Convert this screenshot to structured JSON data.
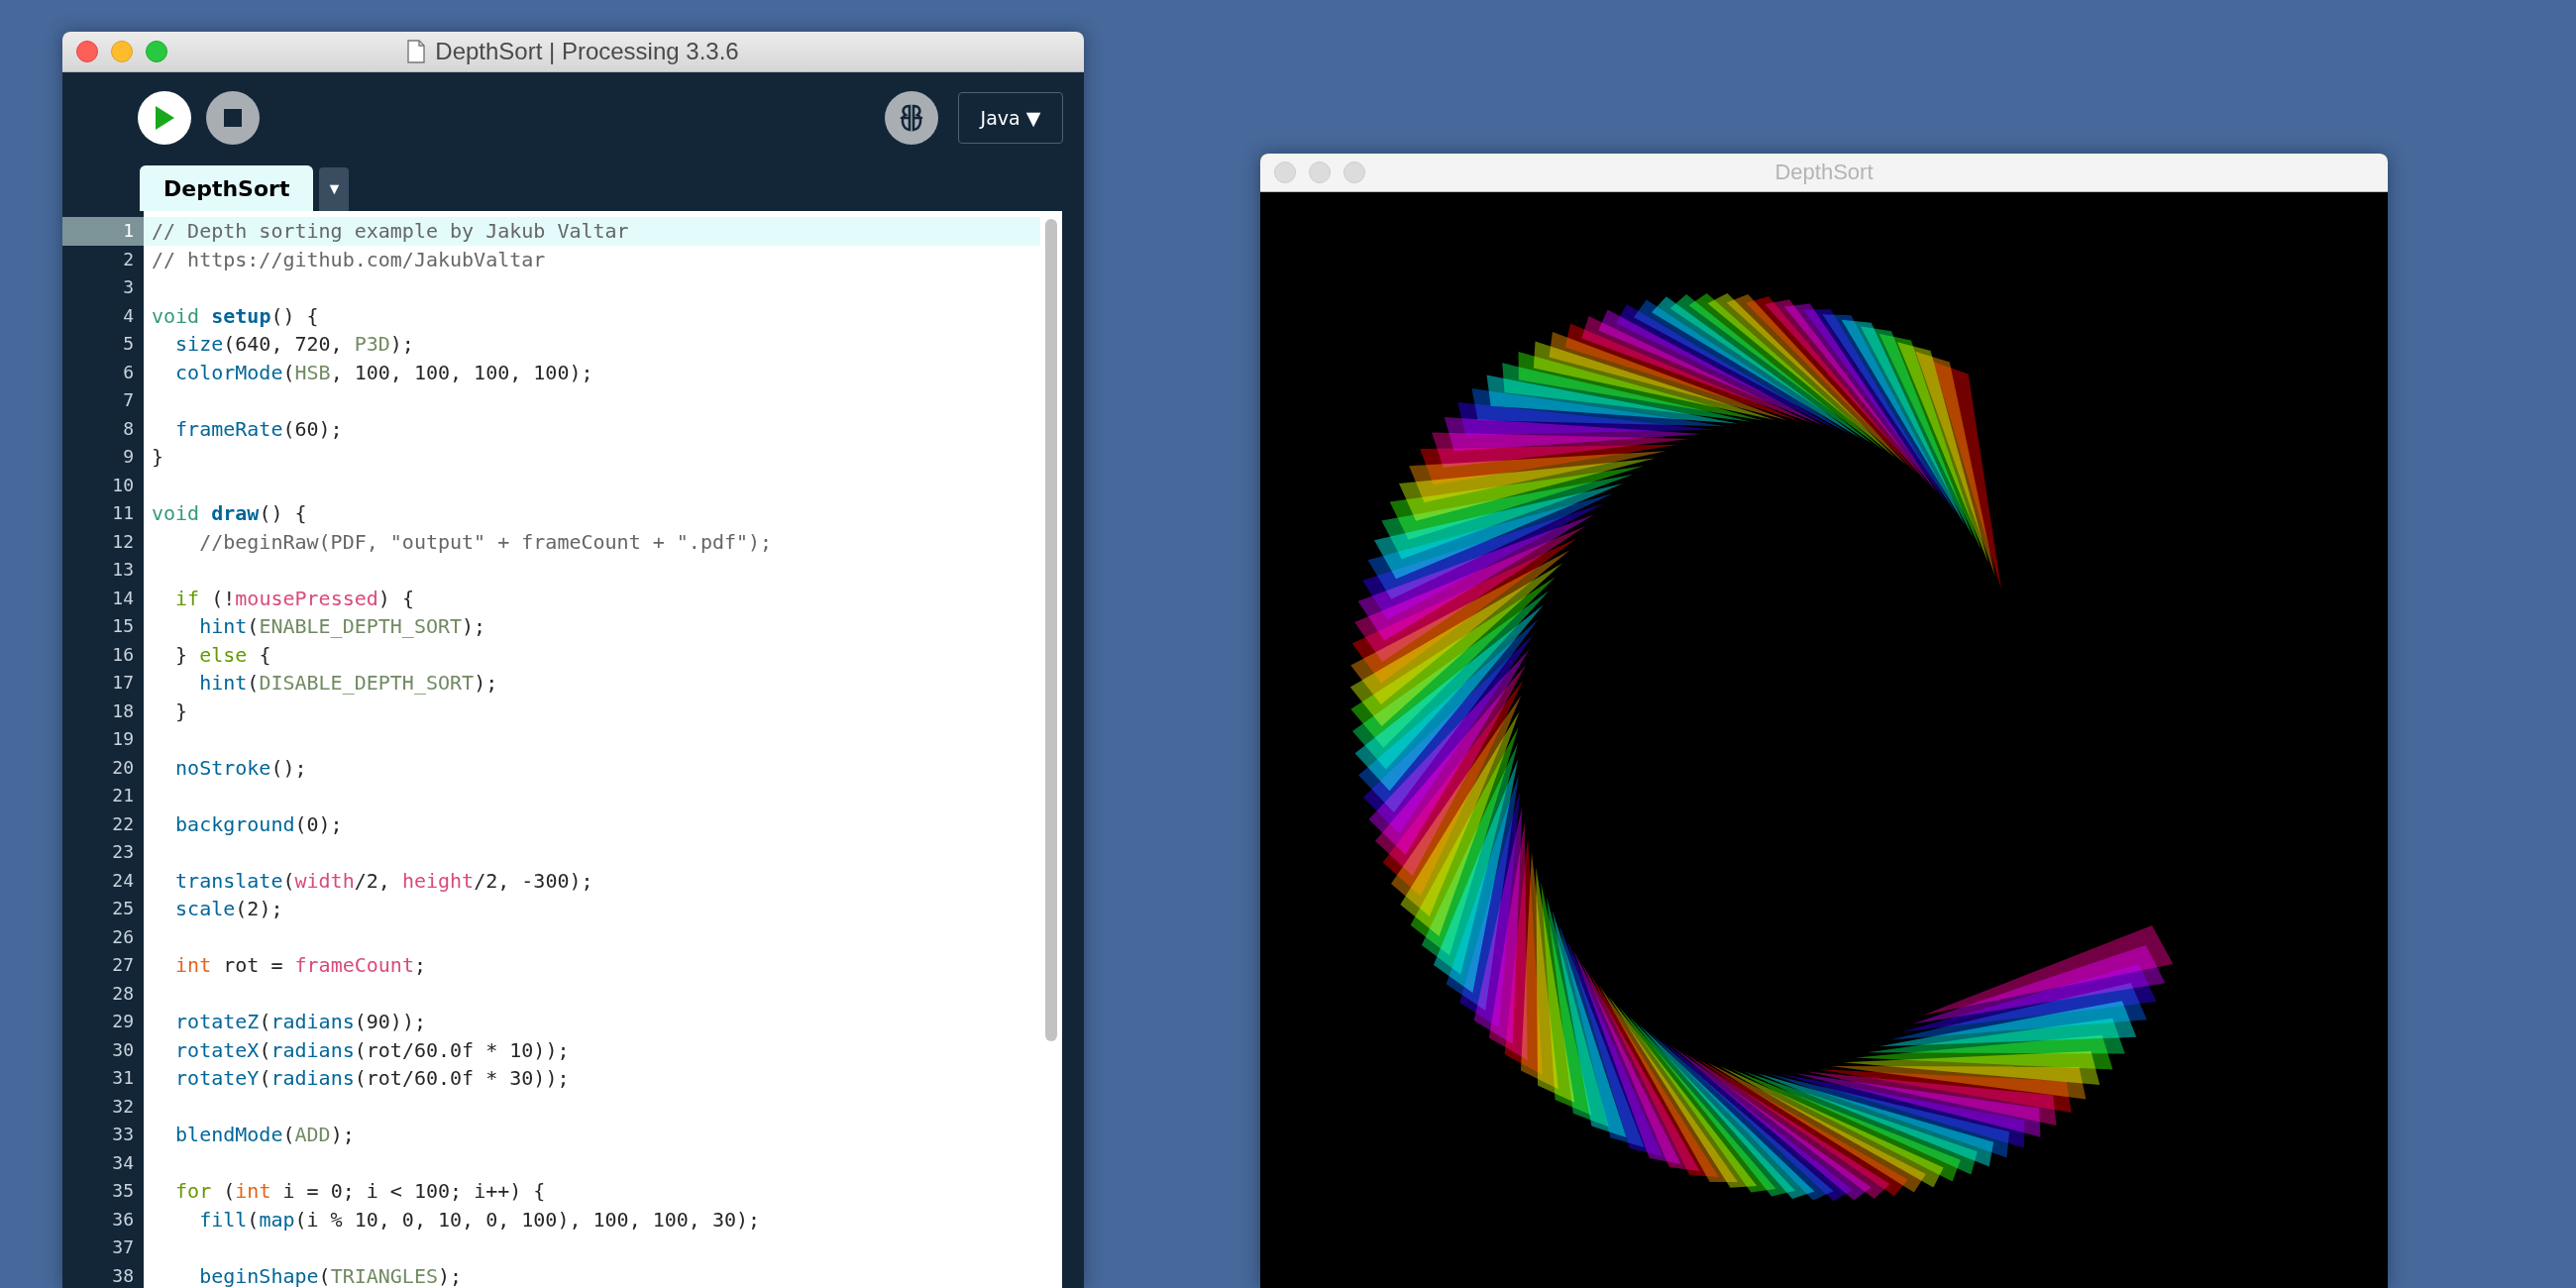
{
  "editor": {
    "title": "DepthSort | Processing 3.3.6",
    "mode": "Java ▼",
    "tabs": [
      {
        "label": "DepthSort",
        "selected": true
      }
    ],
    "tab_menu": "▼",
    "lines": [
      {
        "number": "1",
        "current": true,
        "tokens": [
          {
            "kind": "comment",
            "text": "// Depth sorting example by Jakub Valtar"
          }
        ]
      },
      {
        "number": "2",
        "current": false,
        "tokens": [
          {
            "kind": "comment",
            "text": "// https://github.com/JakubValtar"
          }
        ]
      },
      {
        "number": "3",
        "current": false
      },
      {
        "number": "4",
        "current": false,
        "tokens": [
          {
            "kind": "keyword",
            "text": "void "
          },
          {
            "kind": "function",
            "text": "setup"
          },
          {
            "kind": "plain",
            "text": "() {"
          }
        ]
      },
      {
        "number": "5",
        "current": false,
        "tokens": [
          {
            "kind": "call",
            "text": "  size"
          },
          {
            "kind": "plain",
            "text": "(640, 720, "
          },
          {
            "kind": "constant",
            "text": "P3D"
          },
          {
            "kind": "plain",
            "text": ");"
          }
        ]
      },
      {
        "number": "6",
        "current": false,
        "tokens": [
          {
            "kind": "call",
            "text": "  colorMode"
          },
          {
            "kind": "plain",
            "text": "("
          },
          {
            "kind": "constant",
            "text": "HSB"
          },
          {
            "kind": "plain",
            "text": ", 100, 100, 100, 100);"
          }
        ]
      },
      {
        "number": "7",
        "current": false
      },
      {
        "number": "8",
        "current": false,
        "tokens": [
          {
            "kind": "call",
            "text": "  frameRate"
          },
          {
            "kind": "plain",
            "text": "(60);"
          }
        ]
      },
      {
        "number": "9",
        "current": false,
        "tokens": [
          {
            "kind": "plain",
            "text": "}"
          }
        ]
      },
      {
        "number": "10",
        "current": false
      },
      {
        "number": "11",
        "current": false,
        "tokens": [
          {
            "kind": "keyword",
            "text": "void "
          },
          {
            "kind": "function",
            "text": "draw"
          },
          {
            "kind": "plain",
            "text": "() {"
          }
        ]
      },
      {
        "number": "12",
        "current": false,
        "tokens": [
          {
            "kind": "comment",
            "text": "    //beginRaw(PDF, \"output\" + frameCount + \".pdf\");"
          }
        ]
      },
      {
        "number": "13",
        "current": false
      },
      {
        "number": "14",
        "current": false,
        "tokens": [
          {
            "kind": "control",
            "text": "  if"
          },
          {
            "kind": "plain",
            "text": " (!"
          },
          {
            "kind": "variable",
            "text": "mousePressed"
          },
          {
            "kind": "plain",
            "text": ") {"
          }
        ]
      },
      {
        "number": "15",
        "current": false,
        "tokens": [
          {
            "kind": "call",
            "text": "    hint"
          },
          {
            "kind": "plain",
            "text": "("
          },
          {
            "kind": "constant",
            "text": "ENABLE_DEPTH_SORT"
          },
          {
            "kind": "plain",
            "text": ");"
          }
        ]
      },
      {
        "number": "16",
        "current": false,
        "tokens": [
          {
            "kind": "plain",
            "text": "  } "
          },
          {
            "kind": "control",
            "text": "else"
          },
          {
            "kind": "plain",
            "text": " {"
          }
        ]
      },
      {
        "number": "17",
        "current": false,
        "tokens": [
          {
            "kind": "call",
            "text": "    hint"
          },
          {
            "kind": "plain",
            "text": "("
          },
          {
            "kind": "constant",
            "text": "DISABLE_DEPTH_SORT"
          },
          {
            "kind": "plain",
            "text": ");"
          }
        ]
      },
      {
        "number": "18",
        "current": false,
        "tokens": [
          {
            "kind": "plain",
            "text": "  }"
          }
        ]
      },
      {
        "number": "19",
        "current": false
      },
      {
        "number": "20",
        "current": false,
        "tokens": [
          {
            "kind": "call",
            "text": "  noStroke"
          },
          {
            "kind": "plain",
            "text": "();"
          }
        ]
      },
      {
        "number": "21",
        "current": false
      },
      {
        "number": "22",
        "current": false,
        "tokens": [
          {
            "kind": "call",
            "text": "  background"
          },
          {
            "kind": "plain",
            "text": "(0);"
          }
        ]
      },
      {
        "number": "23",
        "current": false
      },
      {
        "number": "24",
        "current": false,
        "tokens": [
          {
            "kind": "call",
            "text": "  translate"
          },
          {
            "kind": "plain",
            "text": "("
          },
          {
            "kind": "variable",
            "text": "width"
          },
          {
            "kind": "plain",
            "text": "/2, "
          },
          {
            "kind": "variable",
            "text": "height"
          },
          {
            "kind": "plain",
            "text": "/2, -300);"
          }
        ]
      },
      {
        "number": "25",
        "current": false,
        "tokens": [
          {
            "kind": "call",
            "text": "  scale"
          },
          {
            "kind": "plain",
            "text": "(2);"
          }
        ]
      },
      {
        "number": "26",
        "current": false
      },
      {
        "number": "27",
        "current": false,
        "tokens": [
          {
            "kind": "type",
            "text": "  int"
          },
          {
            "kind": "plain",
            "text": " rot = "
          },
          {
            "kind": "variable",
            "text": "frameCount"
          },
          {
            "kind": "plain",
            "text": ";"
          }
        ]
      },
      {
        "number": "28",
        "current": false
      },
      {
        "number": "29",
        "current": false,
        "tokens": [
          {
            "kind": "call",
            "text": "  rotateZ"
          },
          {
            "kind": "plain",
            "text": "("
          },
          {
            "kind": "call",
            "text": "radians"
          },
          {
            "kind": "plain",
            "text": "(90));"
          }
        ]
      },
      {
        "number": "30",
        "current": false,
        "tokens": [
          {
            "kind": "call",
            "text": "  rotateX"
          },
          {
            "kind": "plain",
            "text": "("
          },
          {
            "kind": "call",
            "text": "radians"
          },
          {
            "kind": "plain",
            "text": "(rot/60.0f * 10));"
          }
        ]
      },
      {
        "number": "31",
        "current": false,
        "tokens": [
          {
            "kind": "call",
            "text": "  rotateY"
          },
          {
            "kind": "plain",
            "text": "("
          },
          {
            "kind": "call",
            "text": "radians"
          },
          {
            "kind": "plain",
            "text": "(rot/60.0f * 30));"
          }
        ]
      },
      {
        "number": "32",
        "current": false
      },
      {
        "number": "33",
        "current": false,
        "tokens": [
          {
            "kind": "call",
            "text": "  blendMode"
          },
          {
            "kind": "plain",
            "text": "("
          },
          {
            "kind": "constant",
            "text": "ADD"
          },
          {
            "kind": "plain",
            "text": ");"
          }
        ]
      },
      {
        "number": "34",
        "current": false
      },
      {
        "number": "35",
        "current": false,
        "tokens": [
          {
            "kind": "control",
            "text": "  for"
          },
          {
            "kind": "plain",
            "text": " ("
          },
          {
            "kind": "type",
            "text": "int"
          },
          {
            "kind": "plain",
            "text": " i = 0; i < 100; i++) {"
          }
        ]
      },
      {
        "number": "36",
        "current": false,
        "tokens": [
          {
            "kind": "call",
            "text": "    fill"
          },
          {
            "kind": "plain",
            "text": "("
          },
          {
            "kind": "call",
            "text": "map"
          },
          {
            "kind": "plain",
            "text": "(i % 10, 0, 10, 0, 100), 100, 100, 30);"
          }
        ]
      },
      {
        "number": "37",
        "current": false
      },
      {
        "number": "38",
        "current": false,
        "tokens": [
          {
            "kind": "call",
            "text": "    beginShape"
          },
          {
            "kind": "plain",
            "text": "("
          },
          {
            "kind": "constant",
            "text": "TRIANGLES"
          },
          {
            "kind": "plain",
            "text": ");"
          }
        ]
      }
    ]
  },
  "sketch": {
    "title": "DepthSort"
  }
}
